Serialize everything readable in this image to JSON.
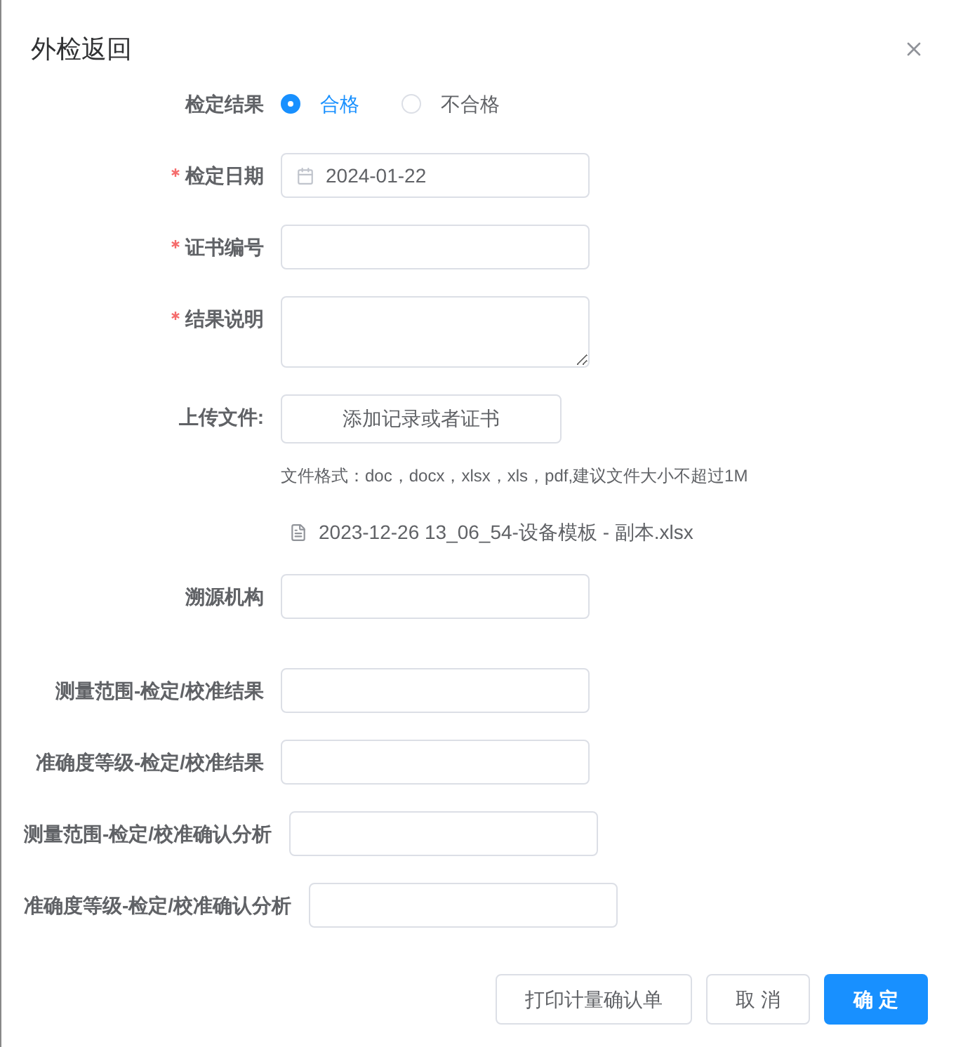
{
  "dialog": {
    "title": "外检返回"
  },
  "form": {
    "rows": [
      {
        "kind": "radio",
        "label": "检定结果",
        "required": false,
        "options": [
          {
            "label": "合格",
            "selected": true
          },
          {
            "label": "不合格",
            "selected": false
          }
        ]
      },
      {
        "kind": "date",
        "label": "检定日期",
        "required": true,
        "value": "2024-01-22"
      },
      {
        "kind": "input",
        "label": "证书编号",
        "required": true
      },
      {
        "kind": "textarea",
        "label": "结果说明",
        "required": true
      },
      {
        "kind": "upload",
        "label": "上传文件:",
        "required": false,
        "button": "添加记录或者证书",
        "hint": "文件格式：doc，docx，xlsx，xls，pdf,建议文件大小不超过1M",
        "files": [
          "2023-12-26 13_06_54-设备模板 - 副本.xlsx"
        ]
      },
      {
        "kind": "input",
        "label": "溯源机构",
        "required": false
      }
    ],
    "measurement_rows": [
      {
        "kind": "input",
        "label": "测量范围-检定/校准结果",
        "required": false
      },
      {
        "kind": "input",
        "label": "准确度等级-检定/校准结果",
        "required": false
      },
      {
        "kind": "input",
        "label": "测量范围-检定/校准确认分析",
        "required": false
      },
      {
        "kind": "input",
        "label": "准确度等级-检定/校准确认分析",
        "required": false
      }
    ]
  },
  "buttons": [
    {
      "kind": "default",
      "label": "打印计量确认单"
    },
    {
      "kind": "default",
      "label": "取 消"
    },
    {
      "kind": "primary",
      "label": "确 定"
    }
  ]
}
